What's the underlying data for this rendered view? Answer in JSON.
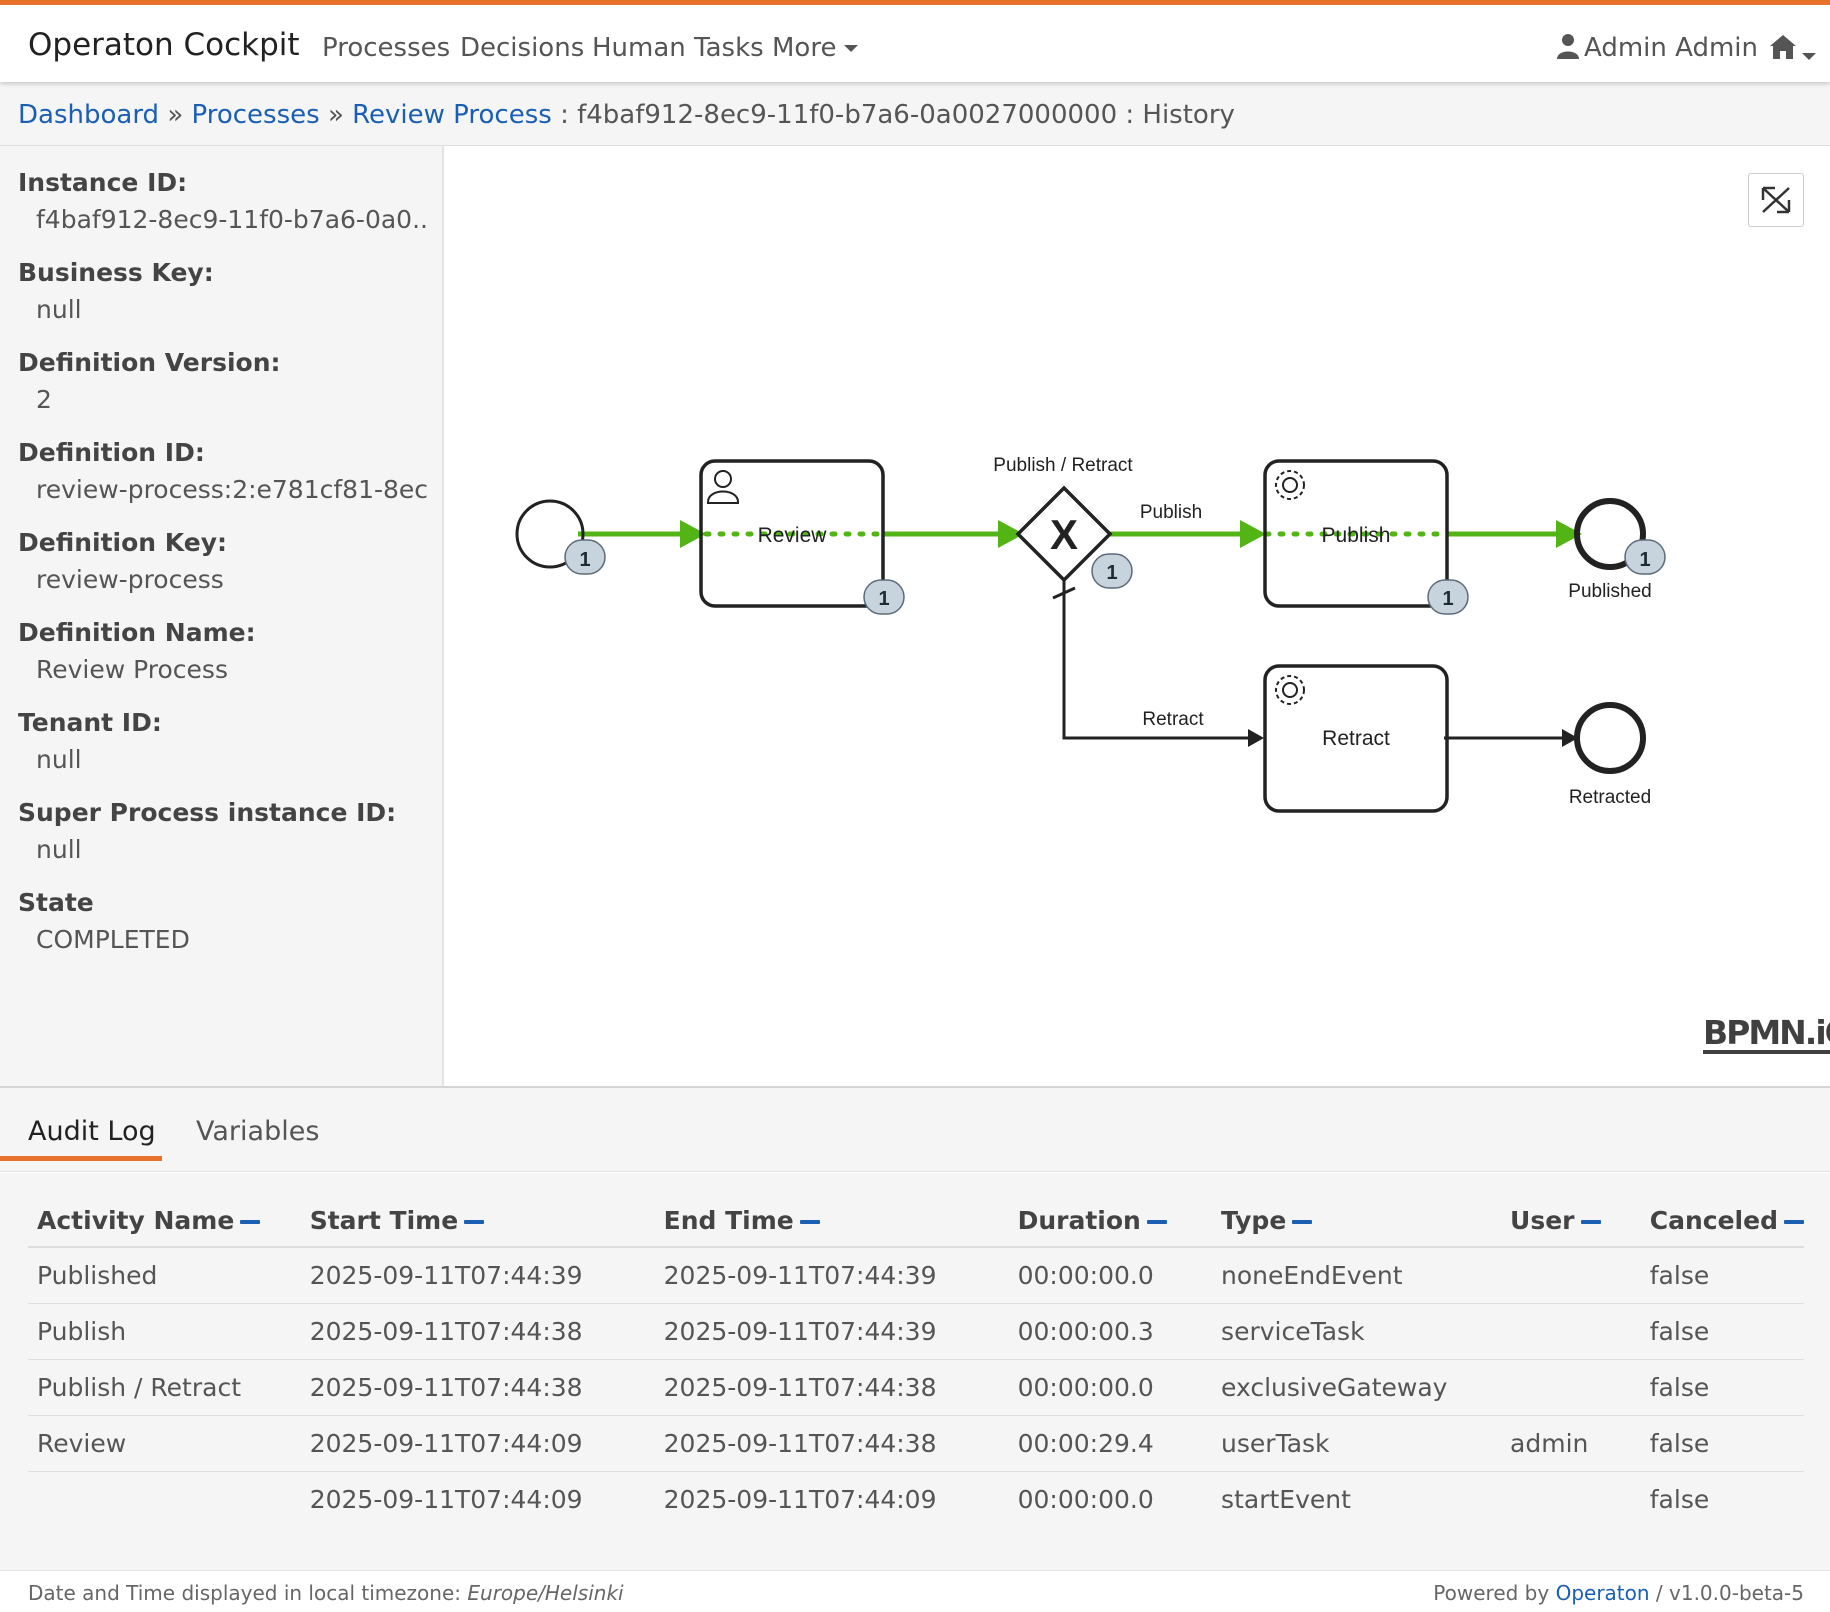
{
  "app": {
    "brand": "Operaton Cockpit",
    "nav": [
      "Processes",
      "Decisions",
      "Human Tasks",
      "More"
    ],
    "user": "Admin Admin"
  },
  "breadcrumb": {
    "dashboard": "Dashboard",
    "sep1": "»",
    "processes": "Processes",
    "sep2": "»",
    "review_process": "Review Process",
    "instance_id": ": f4baf912-8ec9-11f0-b7a6-0a0027000000 : History"
  },
  "sidebar": [
    {
      "label": "Instance ID:",
      "value": "f4baf912-8ec9-11f0-b7a6-0a0..."
    },
    {
      "label": "Business Key:",
      "value": "null"
    },
    {
      "label": "Definition Version:",
      "value": "2"
    },
    {
      "label": "Definition ID:",
      "value": "review-process:2:e781cf81-8ec..."
    },
    {
      "label": "Definition Key:",
      "value": "review-process"
    },
    {
      "label": "Definition Name:",
      "value": "Review Process"
    },
    {
      "label": "Tenant ID:",
      "value": "null"
    },
    {
      "label": "Super Process instance ID:",
      "value": "null"
    },
    {
      "label": "State",
      "value": "COMPLETED"
    }
  ],
  "diagram": {
    "task_review": "Review",
    "gateway_label": "Publish / Retract",
    "flow_publish": "Publish",
    "task_publish": "Publish",
    "end_published": "Published",
    "flow_retract": "Retract",
    "task_retract": "Retract",
    "end_retracted": "Retracted",
    "badge_count": "1",
    "gateway_symbol": "X",
    "watermark": "BPMN.iO",
    "colors": {
      "executed": "#52b415",
      "shape": "#222222",
      "badge": "#c8d4dd"
    }
  },
  "tabs": {
    "audit": "Audit Log",
    "variables": "Variables"
  },
  "audit": {
    "headers": [
      "Activity Name",
      "Start Time",
      "End Time",
      "Duration",
      "Type",
      "User",
      "Canceled"
    ],
    "rows": [
      [
        "Published",
        "2025-09-11T07:44:39",
        "2025-09-11T07:44:39",
        "00:00:00.0",
        "noneEndEvent",
        "",
        "false"
      ],
      [
        "Publish",
        "2025-09-11T07:44:38",
        "2025-09-11T07:44:39",
        "00:00:00.3",
        "serviceTask",
        "",
        "false"
      ],
      [
        "Publish / Retract",
        "2025-09-11T07:44:38",
        "2025-09-11T07:44:38",
        "00:00:00.0",
        "exclusiveGateway",
        "",
        "false"
      ],
      [
        "Review",
        "2025-09-11T07:44:09",
        "2025-09-11T07:44:38",
        "00:00:29.4",
        "userTask",
        "admin",
        "false"
      ],
      [
        "",
        "2025-09-11T07:44:09",
        "2025-09-11T07:44:09",
        "00:00:00.0",
        "startEvent",
        "",
        "false"
      ]
    ]
  },
  "footer": {
    "tz_prefix": "Date and Time displayed in local timezone:",
    "tz": "Europe/Helsinki",
    "powered": "Powered by",
    "brand": "Operaton",
    "version": "/ v1.0.0-beta-5"
  }
}
